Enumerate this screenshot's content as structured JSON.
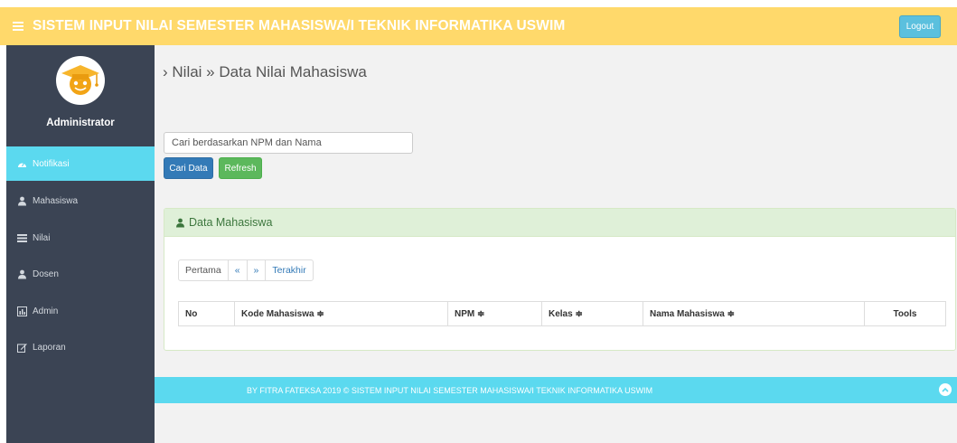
{
  "header": {
    "title": "SISTEM INPUT NILAI SEMESTER MAHASISWA/I TEKNIK INFORMATIKA USWIM",
    "logout_label": "Logout"
  },
  "sidebar": {
    "profile_name": "Administrator",
    "items": [
      {
        "label": "Notifikasi",
        "icon": "dashboard-icon",
        "active": true
      },
      {
        "label": "Mahasiswa",
        "icon": "user-icon"
      },
      {
        "label": "Nilai",
        "icon": "list-icon"
      },
      {
        "label": "Dosen",
        "icon": "user-icon"
      },
      {
        "label": "Admin",
        "icon": "chart-icon"
      },
      {
        "label": "Laporan",
        "icon": "edit-icon"
      }
    ]
  },
  "main": {
    "breadcrumb": "› Nilai » Data Nilai Mahasiswa",
    "search": {
      "placeholder": "Cari berdasarkan NPM dan Nama",
      "value": ""
    },
    "search_button": "Cari Data",
    "refresh_button": "Refresh",
    "panel": {
      "title": "Data Mahasiswa",
      "pagination": [
        "Pertama",
        "«",
        "»",
        "Terakhir"
      ],
      "columns": [
        "No",
        "Kode Mahasiswa ≑",
        "NPM ≑",
        "Kelas ≑",
        "Nama Mahasiswa ≑",
        "Tools"
      ],
      "rows": []
    }
  },
  "footer": {
    "text": "BY FITRA FATEKSA 2019 © SISTEM INPUT NILAI SEMESTER MAHASISWA/I TEKNIK INFORMATIKA USWIM"
  },
  "colors": {
    "header_bg": "#ffd96b",
    "sidebar_bg": "#3b4454",
    "active_item": "#5bd9ef",
    "footer_bg": "#5bd9ef",
    "primary": "#337ab7",
    "success": "#5cb85c"
  }
}
